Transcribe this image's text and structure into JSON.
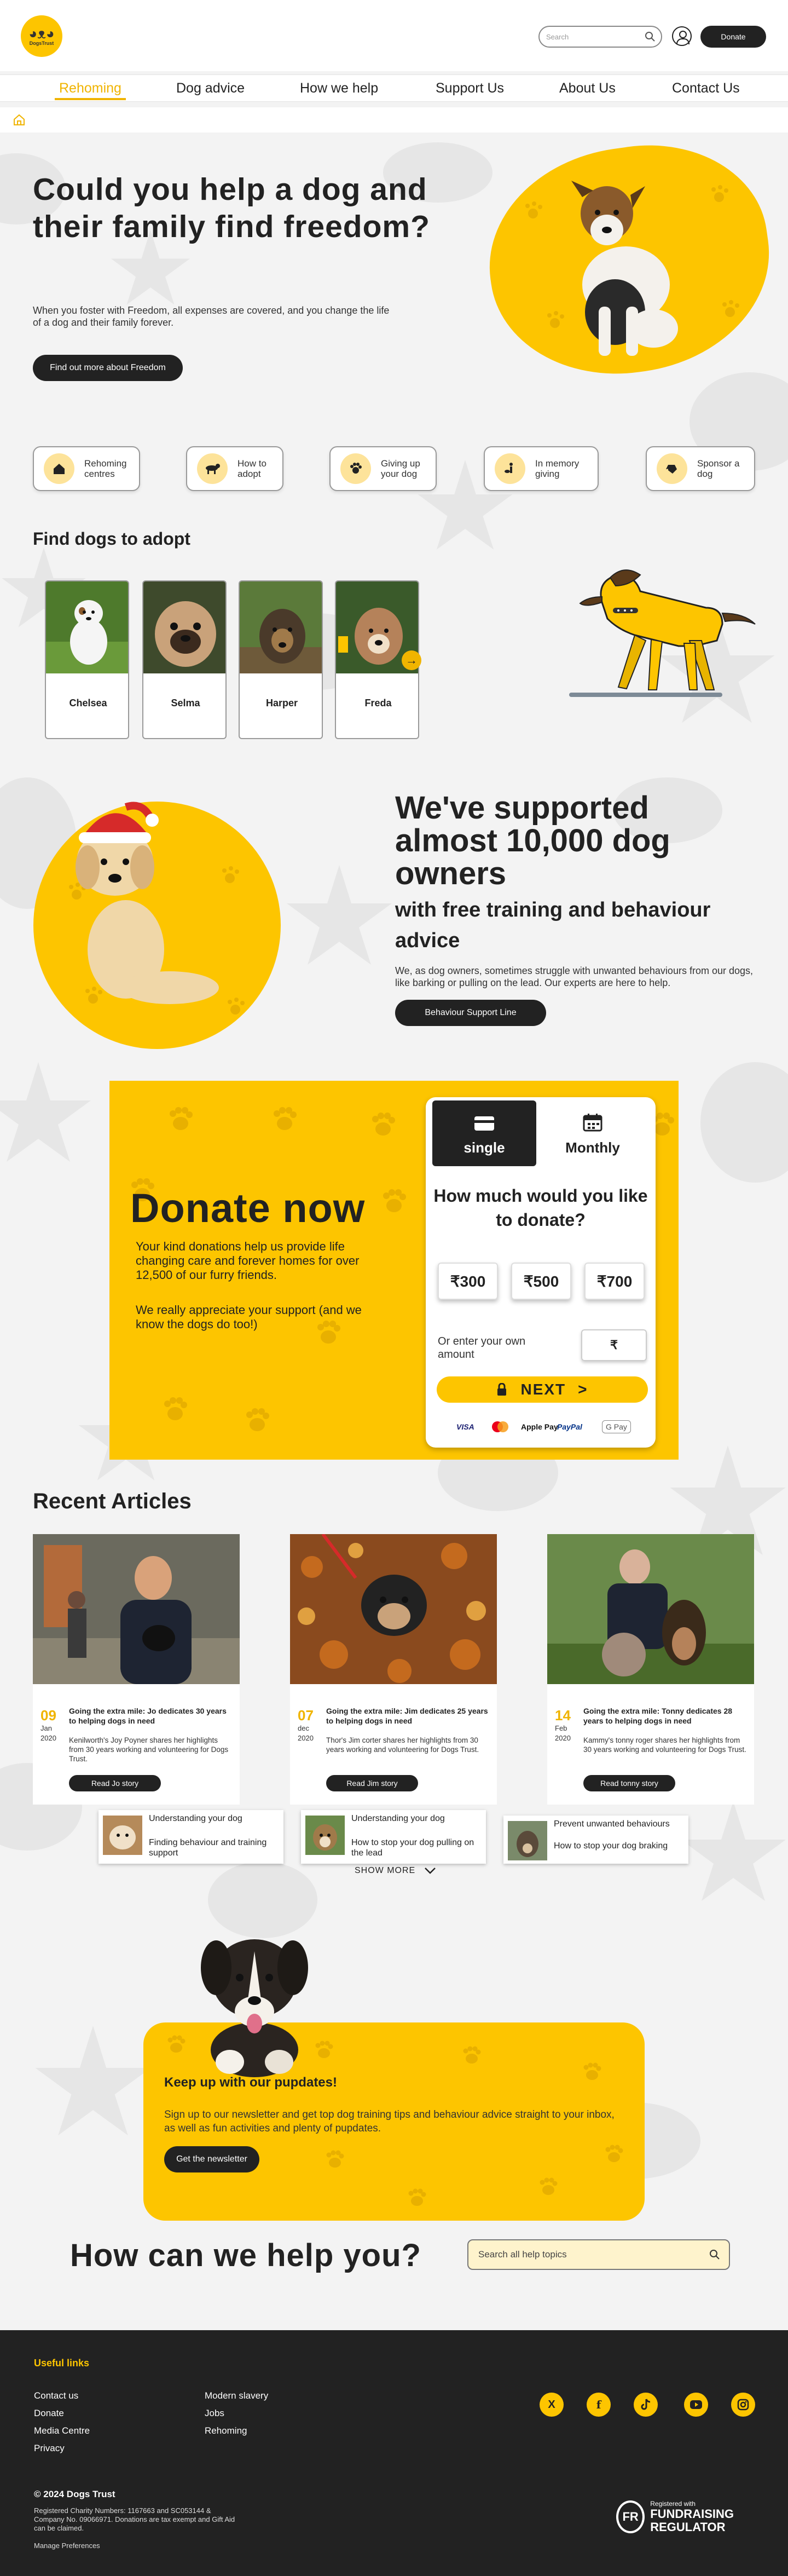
{
  "header": {
    "logo_text": "DogsTrust",
    "search_placeholder": "Search",
    "donate_label": "Donate"
  },
  "nav": {
    "items": [
      {
        "label": "Rehoming",
        "active": true
      },
      {
        "label": "Dog advice"
      },
      {
        "label": "How we help"
      },
      {
        "label": "Support Us"
      },
      {
        "label": "About Us"
      },
      {
        "label": "Contact Us"
      }
    ]
  },
  "hero": {
    "title": "Could you help a dog and their family find freedom?",
    "text": "When you foster with Freedom, all expenses are covered, and you change the life of a dog and their family forever.",
    "button": "Find out more about Freedom"
  },
  "quick_links": [
    {
      "label": "Rehoming centres",
      "icon": "house-icon"
    },
    {
      "label": "How to adopt",
      "icon": "dog-icon"
    },
    {
      "label": "Giving up your dog",
      "icon": "paw-hand-icon"
    },
    {
      "label": "In memory giving",
      "icon": "person-dog-icon"
    },
    {
      "label": "Sponsor a dog",
      "icon": "dog-head-icon"
    }
  ],
  "find_dogs": {
    "title": "Find dogs to adopt",
    "dogs": [
      {
        "name": "Chelsea"
      },
      {
        "name": "Selma"
      },
      {
        "name": "Harper"
      },
      {
        "name": "Freda"
      }
    ]
  },
  "support": {
    "title": "We've supported almost 10,000 dog owners",
    "subtitle": "with free training and behaviour advice",
    "text": "We, as dog owners, sometimes struggle with unwanted behaviours from our dogs, like barking or pulling on the lead. Our experts are here to help.",
    "button": "Behaviour Support Line"
  },
  "donate": {
    "title": "Donate now",
    "text1": "Your kind donations help us provide life changing care and forever homes for over 12,500 of our furry friends.",
    "text2": "We really appreciate your support (and we know the dogs do too!)",
    "tab_single": "single",
    "tab_monthly": "Monthly",
    "question": "How much would you like to donate?",
    "amounts": [
      "₹300",
      "₹500",
      "₹700"
    ],
    "own_label": "Or enter your own amount",
    "own_currency": "₹",
    "next_label": "NEXT",
    "payment_methods": [
      "VISA",
      "Mastercard",
      "Apple Pay",
      "PayPal",
      "G Pay"
    ]
  },
  "articles": {
    "title": "Recent Articles",
    "items": [
      {
        "day": "09",
        "month": "Jan",
        "year": "2020",
        "title": "Going the extra mile: Jo dedicates 30 years to helping dogs in need",
        "excerpt": "Kenilworth's Joy Poyner shares her highlights from 30 years working and volunteering for Dogs Trust.",
        "button": "Read Jo story"
      },
      {
        "day": "07",
        "month": "dec",
        "year": "2020",
        "title": "Going the extra mile: Jim dedicates 25 years to helping dogs in need",
        "excerpt": "Thor's Jim corter shares her highlights from 30 years working and volunteering for Dogs Trust.",
        "button": "Read Jim story"
      },
      {
        "day": "14",
        "month": "Feb",
        "year": "2020",
        "title": "Going the extra mile: Tonny dedicates 28 years to helping dogs in need",
        "excerpt": "Kammy's tonny roger shares her highlights from 30 years working and volunteering for Dogs Trust.",
        "button": "Read tonny story"
      }
    ],
    "minis": [
      {
        "category": "Understanding your dog",
        "title": "Finding behaviour and training support"
      },
      {
        "category": "Understanding your dog",
        "title": "How to stop your dog pulling on the lead"
      },
      {
        "category": "Prevent unwanted behaviours",
        "title": "How to stop your dog braking"
      }
    ],
    "show_more": "SHOW MORE"
  },
  "newsletter": {
    "title": "Keep up with our pupdates!",
    "text": "Sign up to our newsletter and get top dog training tips and behaviour advice straight to your inbox, as well as fun activities and plenty of pupdates.",
    "button": "Get the newsletter"
  },
  "help": {
    "title": "How can we help you?",
    "search_placeholder": "Search all help topics"
  },
  "footer": {
    "heading": "Useful links",
    "col1": [
      "Contact us",
      "Donate",
      "Media Centre",
      "Privacy"
    ],
    "col2": [
      "Modern slavery",
      "Jobs",
      "Rehoming"
    ],
    "social": [
      "X",
      "f",
      "tiktok",
      "youtube",
      "instagram"
    ],
    "copyright": "© 2024 Dogs Trust",
    "registered": "Registered Charity Numbers: 1167663 and SC053144 & Company No. 09066971. Donations are tax exempt and Gift Aid can be claimed.",
    "manage": "Manage Preferences",
    "regulator_top": "Registered with",
    "regulator_name": "FUNDRAISING REGULATOR",
    "regulator_badge": "FR"
  },
  "colors": {
    "brand_yellow": "#fdc500",
    "dark": "#222222",
    "accent": "#f0b400"
  }
}
